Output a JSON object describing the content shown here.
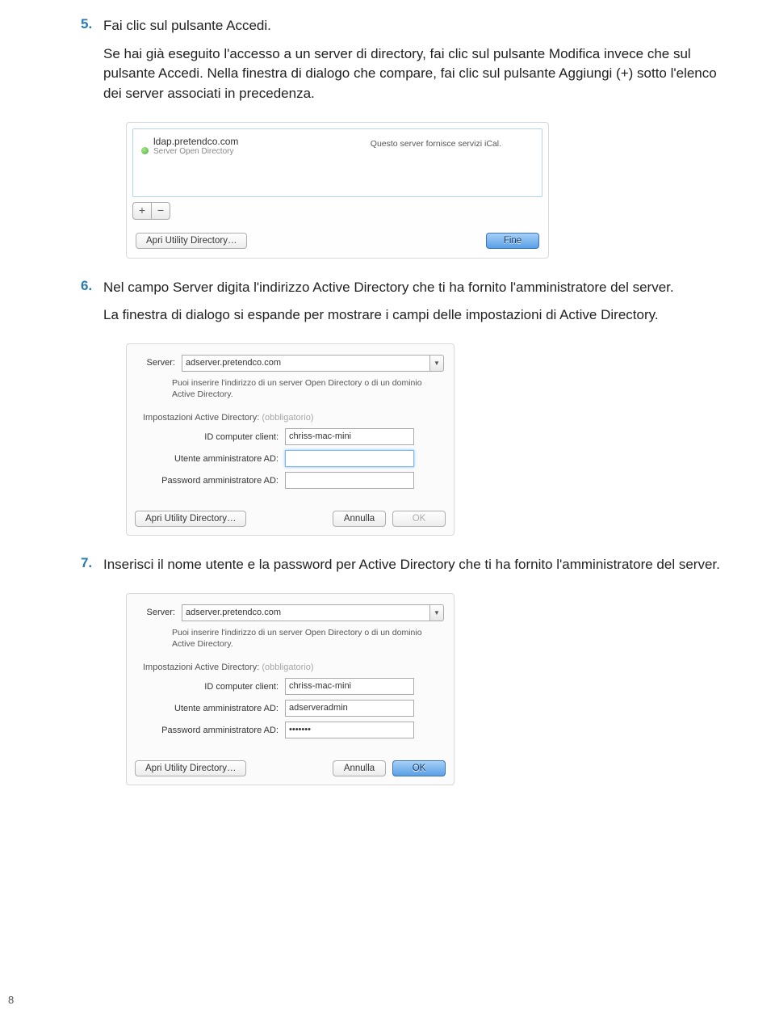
{
  "page_number": "8",
  "steps": {
    "s5": {
      "num": "5.",
      "title": "Fai clic sul pulsante Accedi.",
      "body": "Se hai già eseguito l'accesso a un server di directory, fai clic sul pulsante Modifica invece che sul pulsante Accedi. Nella finestra di dialogo che compare, fai clic sul pulsante Aggiungi (+) sotto l'elenco dei server associati in precedenza."
    },
    "s6": {
      "num": "6.",
      "title": "Nel campo Server digita l'indirizzo Active Directory che ti ha fornito l'amministratore del server.",
      "body": "La finestra di dialogo si espande per mostrare i campi delle impostazioni di Active Directory."
    },
    "s7": {
      "num": "7.",
      "title": "Inserisci il nome utente e la password per Active Directory che ti ha fornito l'amministratore del server."
    }
  },
  "dlg1": {
    "host": "ldap.pretendco.com",
    "subtype": "Server Open Directory",
    "service_msg": "Questo server fornisce servizi iCal.",
    "plus": "+",
    "minus": "−",
    "util_btn": "Apri Utility Directory…",
    "done_btn": "Fine"
  },
  "dlg2a": {
    "server_label": "Server:",
    "server_value": "adserver.pretendco.com",
    "hint": "Puoi inserire l'indirizzo di un server Open Directory o di un dominio Active Directory.",
    "section": "Impostazioni Active Directory:",
    "section_note": "(obbligatorio)",
    "id_label": "ID computer client:",
    "id_value": "chriss-mac-mini",
    "user_label": "Utente amministratore AD:",
    "user_value": "",
    "pass_label": "Password amministratore AD:",
    "pass_value": "",
    "util_btn": "Apri Utility Directory…",
    "cancel_btn": "Annulla",
    "ok_btn": "OK"
  },
  "dlg2b": {
    "server_label": "Server:",
    "server_value": "adserver.pretendco.com",
    "hint": "Puoi inserire l'indirizzo di un server Open Directory o di un dominio Active Directory.",
    "section": "Impostazioni Active Directory:",
    "section_note": "(obbligatorio)",
    "id_label": "ID computer client:",
    "id_value": "chriss-mac-mini",
    "user_label": "Utente amministratore AD:",
    "user_value": "adserveradmin",
    "pass_label": "Password amministratore AD:",
    "pass_value": "•••••••",
    "util_btn": "Apri Utility Directory…",
    "cancel_btn": "Annulla",
    "ok_btn": "OK"
  }
}
